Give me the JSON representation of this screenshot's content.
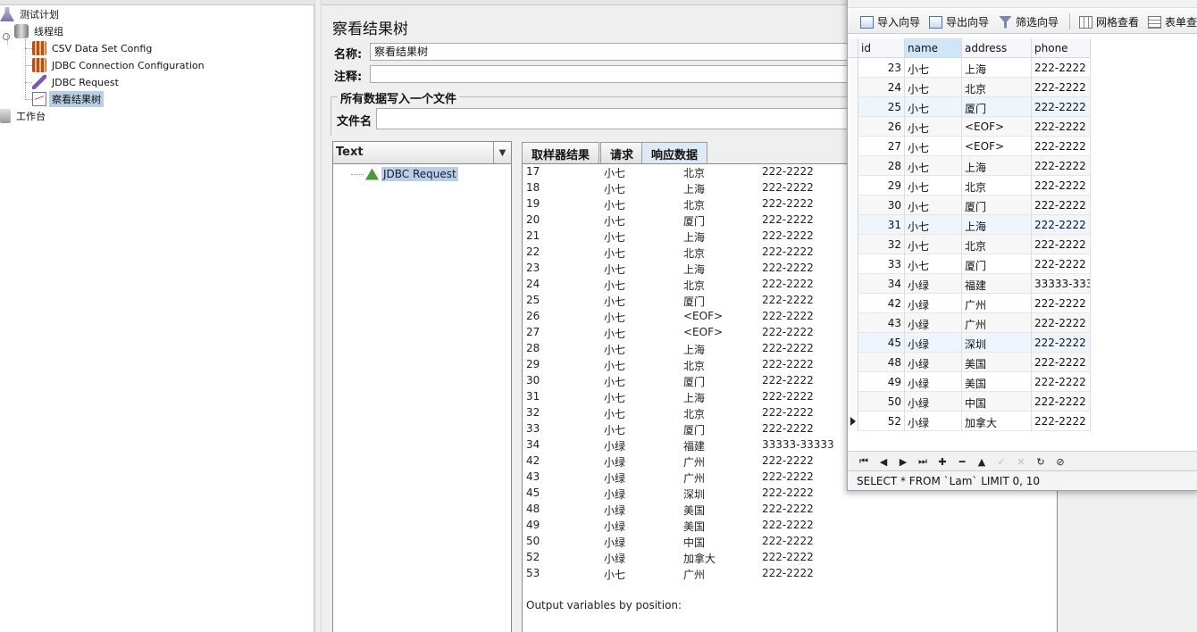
{
  "tree": {
    "items": [
      {
        "label": "测试计划",
        "icon": "flask-icon"
      },
      {
        "label": "线程组",
        "icon": "spool-icon"
      },
      {
        "label": "CSV Data Set Config",
        "icon": "config-icon"
      },
      {
        "label": "JDBC Connection Configuration",
        "icon": "config-icon"
      },
      {
        "label": "JDBC Request",
        "icon": "pen-icon"
      },
      {
        "label": "察看结果树",
        "icon": "graph-icon"
      },
      {
        "label": "工作台",
        "icon": "workbench-icon"
      }
    ]
  },
  "main": {
    "title": "察看结果树",
    "name_label": "名称:",
    "name_value": "察看结果树",
    "comment_label": "注释:",
    "file_group_title": "所有数据写入一个文件",
    "file_label": "文件名",
    "renderer": "Text",
    "sample_label": "JDBC Request",
    "tabs": [
      "取样器结果",
      "请求",
      "响应数据"
    ],
    "active_tab": "响应数据",
    "response_rows": [
      [
        "17",
        "小七",
        "北京",
        "222-2222"
      ],
      [
        "18",
        "小七",
        "上海",
        "222-2222"
      ],
      [
        "19",
        "小七",
        "北京",
        "222-2222"
      ],
      [
        "20",
        "小七",
        "厦门",
        "222-2222"
      ],
      [
        "21",
        "小七",
        "上海",
        "222-2222"
      ],
      [
        "22",
        "小七",
        "北京",
        "222-2222"
      ],
      [
        "23",
        "小七",
        "上海",
        "222-2222"
      ],
      [
        "24",
        "小七",
        "北京",
        "222-2222"
      ],
      [
        "25",
        "小七",
        "厦门",
        "222-2222"
      ],
      [
        "26",
        "小七",
        "<EOF>",
        "222-2222"
      ],
      [
        "27",
        "小七",
        "<EOF>",
        "222-2222"
      ],
      [
        "28",
        "小七",
        "上海",
        "222-2222"
      ],
      [
        "29",
        "小七",
        "北京",
        "222-2222"
      ],
      [
        "30",
        "小七",
        "厦门",
        "222-2222"
      ],
      [
        "31",
        "小七",
        "上海",
        "222-2222"
      ],
      [
        "32",
        "小七",
        "北京",
        "222-2222"
      ],
      [
        "33",
        "小七",
        "厦门",
        "222-2222"
      ],
      [
        "34",
        "小绿",
        "福建",
        "33333-33333"
      ],
      [
        "42",
        "小绿",
        "广州",
        "222-2222"
      ],
      [
        "43",
        "小绿",
        "广州",
        "222-2222"
      ],
      [
        "45",
        "小绿",
        "深圳",
        "222-2222"
      ],
      [
        "48",
        "小绿",
        "美国",
        "222-2222"
      ],
      [
        "49",
        "小绿",
        "美国",
        "222-2222"
      ],
      [
        "50",
        "小绿",
        "中国",
        "222-2222"
      ],
      [
        "52",
        "小绿",
        "加拿大",
        "222-2222"
      ],
      [
        "53",
        "小七",
        "广州",
        "222-2222"
      ]
    ],
    "output_vars": "Output variables by position:"
  },
  "navicat": {
    "toolbar": [
      {
        "label": "导入向导",
        "icon": "import-icon"
      },
      {
        "label": "导出向导",
        "icon": "export-icon"
      },
      {
        "label": "筛选向导",
        "icon": "filter-icon"
      },
      {
        "label": "网格查看",
        "icon": "grid-view-icon"
      },
      {
        "label": "表单查",
        "icon": "form-view-icon"
      }
    ],
    "columns": [
      "id",
      "name",
      "address",
      "phone"
    ],
    "selected_column": "name",
    "rows": [
      [
        "23",
        "小七",
        "上海",
        "222-2222"
      ],
      [
        "24",
        "小七",
        "北京",
        "222-2222"
      ],
      [
        "25",
        "小七",
        "厦门",
        "222-2222"
      ],
      [
        "26",
        "小七",
        "<EOF>",
        "222-2222"
      ],
      [
        "27",
        "小七",
        "<EOF>",
        "222-2222"
      ],
      [
        "28",
        "小七",
        "上海",
        "222-2222"
      ],
      [
        "29",
        "小七",
        "北京",
        "222-2222"
      ],
      [
        "30",
        "小七",
        "厦门",
        "222-2222"
      ],
      [
        "31",
        "小七",
        "上海",
        "222-2222"
      ],
      [
        "32",
        "小七",
        "北京",
        "222-2222"
      ],
      [
        "33",
        "小七",
        "厦门",
        "222-2222"
      ],
      [
        "34",
        "小绿",
        "福建",
        "33333-333"
      ],
      [
        "42",
        "小绿",
        "广州",
        "222-2222"
      ],
      [
        "43",
        "小绿",
        "广州",
        "222-2222"
      ],
      [
        "45",
        "小绿",
        "深圳",
        "222-2222"
      ],
      [
        "48",
        "小绿",
        "美国",
        "222-2222"
      ],
      [
        "49",
        "小绿",
        "美国",
        "222-2222"
      ],
      [
        "50",
        "小绿",
        "中国",
        "222-2222"
      ],
      [
        "52",
        "小绿",
        "加拿大",
        "222-2222"
      ]
    ],
    "current_row_id": "52",
    "nav_buttons": [
      {
        "glyph": "⏮",
        "name": "first-record-button"
      },
      {
        "glyph": "◀",
        "name": "prev-record-button"
      },
      {
        "glyph": "▶",
        "name": "next-record-button"
      },
      {
        "glyph": "⏭",
        "name": "last-record-button"
      },
      {
        "glyph": "✚",
        "name": "add-record-button"
      },
      {
        "glyph": "━",
        "name": "delete-record-button"
      },
      {
        "glyph": "▲",
        "name": "edit-record-button"
      },
      {
        "glyph": "✓",
        "name": "apply-button"
      },
      {
        "glyph": "✕",
        "name": "discard-button"
      },
      {
        "glyph": "↻",
        "name": "refresh-button"
      },
      {
        "glyph": "⊘",
        "name": "stop-button"
      }
    ],
    "status": "SELECT * FROM `Lam` LIMIT 0, 10"
  }
}
